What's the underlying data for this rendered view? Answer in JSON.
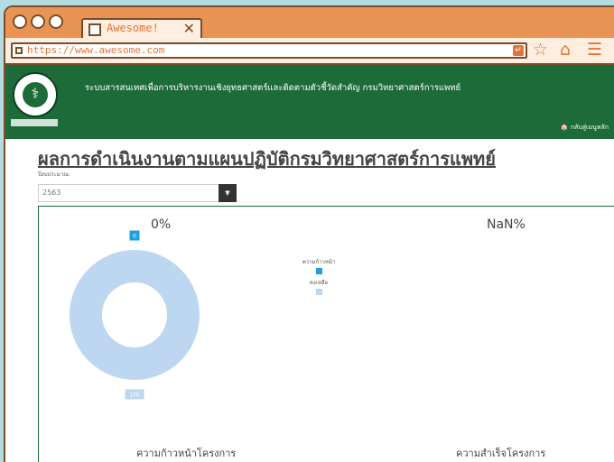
{
  "browser": {
    "tab_title": "Awesome!",
    "tab_close": "✕",
    "url": "https://www.awesome.com",
    "addr_go_icon": "search-icon",
    "star_icon": "☆",
    "home_icon": "⌂",
    "menu_icon": "☰",
    "addr_btn_glyph": "↵"
  },
  "header": {
    "site_title": "ระบบสารสนเทศเพื่อการบริหารงานเชิงยุทธศาสตร์และติดตามตัวชี้วัดสำคัญ กรมวิทยาศาสตร์การแพทย์",
    "back_link": "🏠 กลับสู่เมนูหลัก",
    "logo_glyph": "⚕"
  },
  "main": {
    "page_title": "ผลการดำเนินงานตามแผนปฏิบัติกรมวิทยาศาสตร์การแพทย์",
    "year_label": "ปีงบประมาณ:",
    "year_value": "2563",
    "year_dropdown_glyph": "▼"
  },
  "chart_data": {
    "type": "pie",
    "chart1": {
      "percent_label": "0%",
      "categories": [
        "ความก้าวหน้า",
        "คงเหลือ"
      ],
      "values": [
        0,
        100
      ],
      "colors": [
        "#1ea0e0",
        "#bcd7ef"
      ],
      "caption": "ความก้าวหน้าโครงการ"
    },
    "chart2": {
      "percent_label": "NaN%",
      "caption": "ความสำเร็จโครงการ"
    },
    "legend": [
      {
        "label": "ความก้าวหน้า",
        "color": "#1ea0e0"
      },
      {
        "label": "คงเหลือ",
        "color": "#bcd7ef"
      }
    ]
  }
}
